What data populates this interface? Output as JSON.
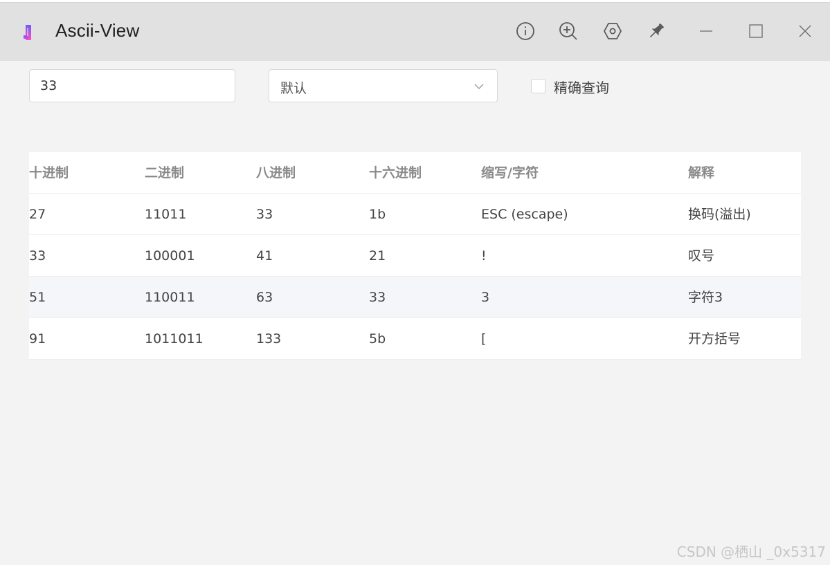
{
  "window": {
    "title": "Ascii-View",
    "controls": {
      "info_icon": "info-icon",
      "zoom_icon": "zoom-in-icon",
      "settings_icon": "hexagon-settings-icon",
      "pin_icon": "pin-icon",
      "minimize_icon": "minimize-icon",
      "maximize_icon": "maximize-icon",
      "close_icon": "close-icon"
    }
  },
  "toolbar": {
    "search_value": "33",
    "select_value": "默认",
    "exact_label": "精确查询",
    "exact_checked": false
  },
  "table": {
    "headers": [
      "十进制",
      "二进制",
      "八进制",
      "十六进制",
      "缩写/字符",
      "解释"
    ],
    "rows": [
      [
        "27",
        "11011",
        "33",
        "1b",
        "ESC (escape)",
        "换码(溢出)"
      ],
      [
        "33",
        "100001",
        "41",
        "21",
        "!",
        "叹号"
      ],
      [
        "51",
        "110011",
        "63",
        "33",
        "3",
        "字符3"
      ],
      [
        "91",
        "1011011",
        "133",
        "5b",
        "[",
        "开方括号"
      ]
    ]
  },
  "watermark": "CSDN @栖山 _0x5317",
  "colors": {
    "titlebar_bg": "#e1e1e1",
    "page_bg": "#f3f3f3",
    "row_hover": "#f5f6f9",
    "header_text": "#8a8a8a"
  }
}
